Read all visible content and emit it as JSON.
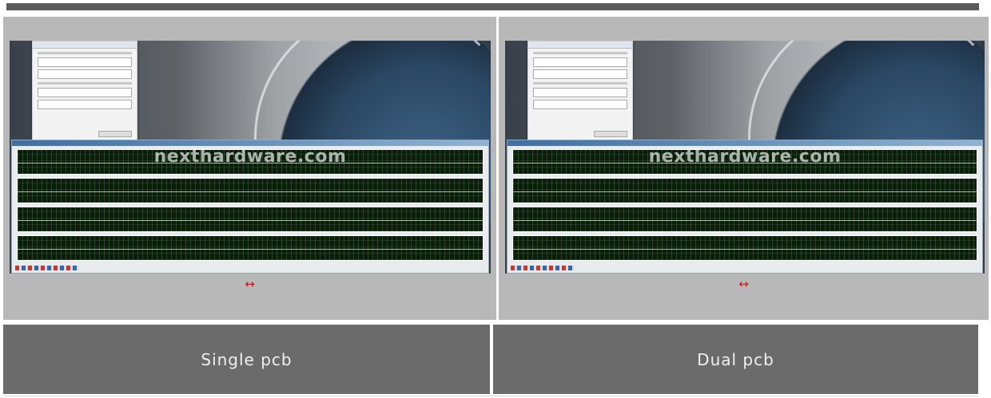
{
  "images": [
    {
      "caption": "Single pcb",
      "watermark": "nexthardware.com",
      "arrow": "↔"
    },
    {
      "caption": "Dual pcb",
      "watermark": "nexthardware.com",
      "arrow": "↔"
    }
  ],
  "colors": {
    "topbar": "#5b5b5b",
    "panel_bg": "#b8b8b8",
    "caption_bg": "#6b6b6b",
    "arrow": "#d61414"
  }
}
